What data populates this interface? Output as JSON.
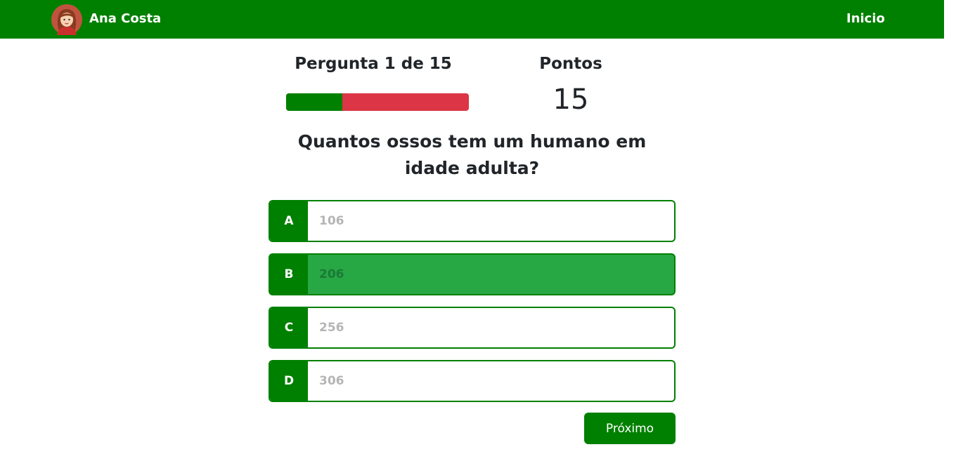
{
  "navbar": {
    "user_name": "Ana Costa",
    "avatar_icon": "user-avatar-icon",
    "home_label": "Inicio",
    "color": "#008000"
  },
  "quiz": {
    "question_counter": "Pergunta 1 de 15",
    "progress_fraction": 0.3077,
    "points_label": "Pontos",
    "points_value": "15",
    "question": "Quantos ossos tem um humano em idade adulta?",
    "options": [
      {
        "letter": "A",
        "text": "106",
        "selected": false
      },
      {
        "letter": "B",
        "text": "206",
        "selected": true
      },
      {
        "letter": "C",
        "text": "256",
        "selected": false
      },
      {
        "letter": "D",
        "text": "306",
        "selected": false
      }
    ],
    "next_label": "Próximo"
  },
  "colors": {
    "primary": "#008000",
    "progress_remaining": "#dc3545",
    "selected_option": "#28a745"
  }
}
